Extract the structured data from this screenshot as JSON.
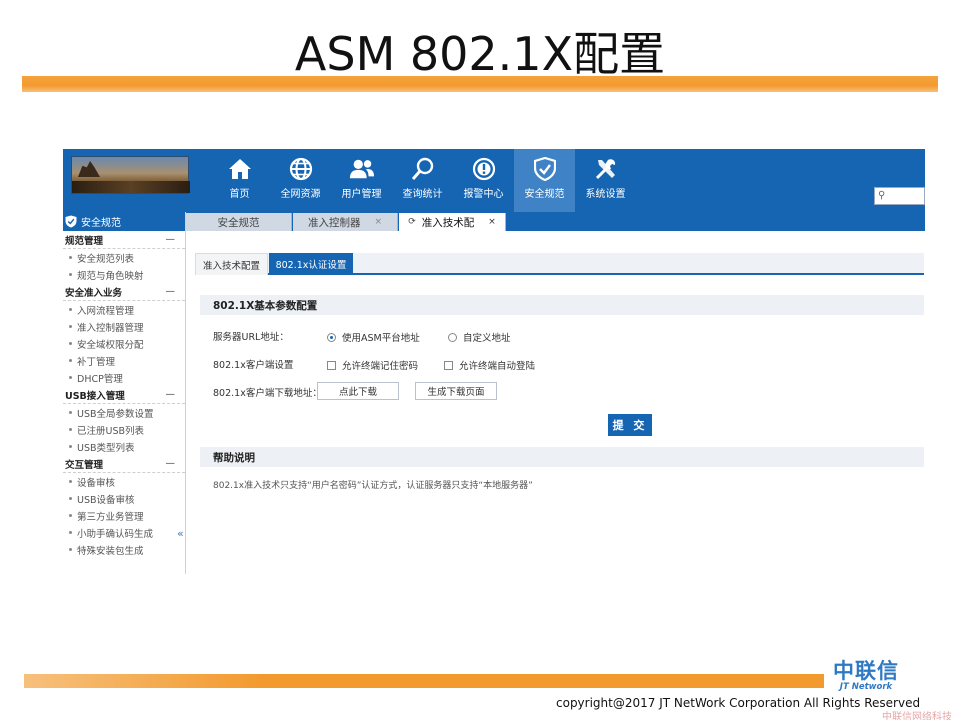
{
  "slide": {
    "title": "ASM 802.1X配置",
    "copyright": "copyright@2017  JT NetWork Corporation All Rights Reserved",
    "brand_cn": "中联信",
    "brand_en": "JT Network",
    "watermark": "中联信网络科技"
  },
  "topnav": {
    "items": [
      {
        "label": "首页",
        "icon": "home-icon"
      },
      {
        "label": "全网资源",
        "icon": "globe-icon"
      },
      {
        "label": "用户管理",
        "icon": "users-icon"
      },
      {
        "label": "查询统计",
        "icon": "magnifier-icon"
      },
      {
        "label": "报警中心",
        "icon": "alert-icon"
      },
      {
        "label": "安全规范",
        "icon": "shield-check-icon",
        "active": true
      },
      {
        "label": "系统设置",
        "icon": "tools-icon"
      }
    ],
    "search_placeholder": ""
  },
  "sidebar": {
    "header": "安全规范",
    "collapse_glyph": "«",
    "groups": [
      {
        "title": "规范管理",
        "toggle": "—",
        "items": [
          "安全规范列表",
          "规范与角色映射"
        ]
      },
      {
        "title": "安全准入业务",
        "toggle": "—",
        "items": [
          "入网流程管理",
          "准入控制器管理",
          "安全域权限分配",
          "补丁管理",
          "DHCP管理"
        ]
      },
      {
        "title": "USB接入管理",
        "toggle": "—",
        "items": [
          "USB全局参数设置",
          "已注册USB列表",
          "USB类型列表"
        ]
      },
      {
        "title": "交互管理",
        "toggle": "—",
        "items": [
          "设备审核",
          "USB设备审核",
          "第三方业务管理",
          "小助手确认码生成",
          "特殊安装包生成"
        ]
      }
    ]
  },
  "tabs": [
    {
      "label": "安全规范",
      "close": ""
    },
    {
      "label": "准入控制器",
      "close": "×"
    },
    {
      "label": "准入技术配",
      "close": "×",
      "active": true,
      "refresh": "⟳"
    }
  ],
  "subtabs": [
    {
      "label": "准入技术配置"
    },
    {
      "label": "802.1x认证设置",
      "active": true
    }
  ],
  "form": {
    "section_title": "802.1X基本参数配置",
    "server_url_label": "服务器URL地址：",
    "opt_asm_url": "使用ASM平台地址",
    "opt_custom_url": "自定义地址",
    "client_setting_label": "802.1x客户端设置",
    "opt_remember_pwd": "允许终端记住密码",
    "opt_auto_login": "允许终端自动登陆",
    "client_download_label": "802.1x客户端下载地址：",
    "btn_download": "点此下载",
    "btn_generate_page": "生成下载页面",
    "btn_submit": "提 交"
  },
  "help": {
    "title": "帮助说明",
    "text": "802.1x准入技术只支持“用户名密码”认证方式，认证服务器只支持“本地服务器”"
  }
}
